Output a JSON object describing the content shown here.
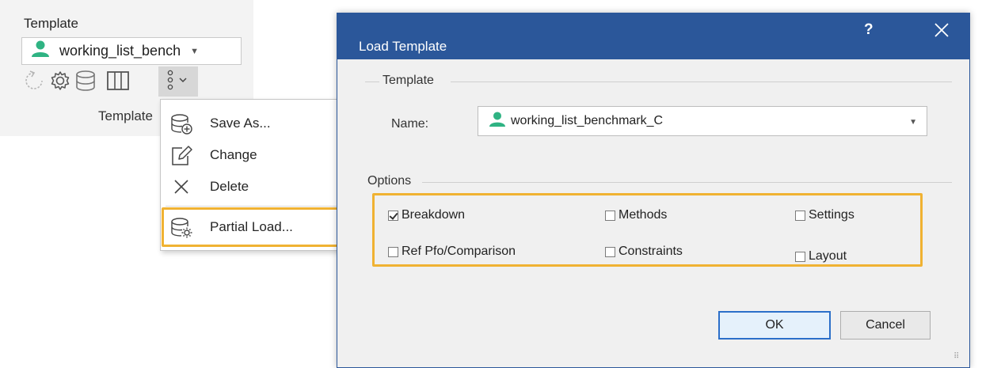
{
  "ribbon": {
    "title": "Template",
    "selected_template": "working_list_bench",
    "caption": "Template"
  },
  "menu": {
    "items": [
      {
        "label": "Save As...",
        "icon": "database-add-icon"
      },
      {
        "label": "Change",
        "icon": "edit-icon"
      },
      {
        "label": "Delete",
        "icon": "close-icon"
      },
      {
        "label": "Partial Load...",
        "icon": "database-gear-icon"
      }
    ]
  },
  "dialog": {
    "title": "Load Template",
    "help": "?",
    "template_group": "Template",
    "name_label": "Name:",
    "name_value": "working_list_benchmark_C",
    "options_group": "Options",
    "options": [
      {
        "label": "Breakdown",
        "checked": true
      },
      {
        "label": "Methods",
        "checked": false
      },
      {
        "label": "Settings",
        "checked": false
      },
      {
        "label": "Ref Pfo/Comparison",
        "checked": false
      },
      {
        "label": "Constraints",
        "checked": false
      },
      {
        "label": "Layout",
        "checked": false
      }
    ],
    "ok_label": "OK",
    "cancel_label": "Cancel"
  },
  "colors": {
    "titlebar": "#2b579a",
    "highlight": "#f0b232",
    "person": "#2fb383"
  }
}
